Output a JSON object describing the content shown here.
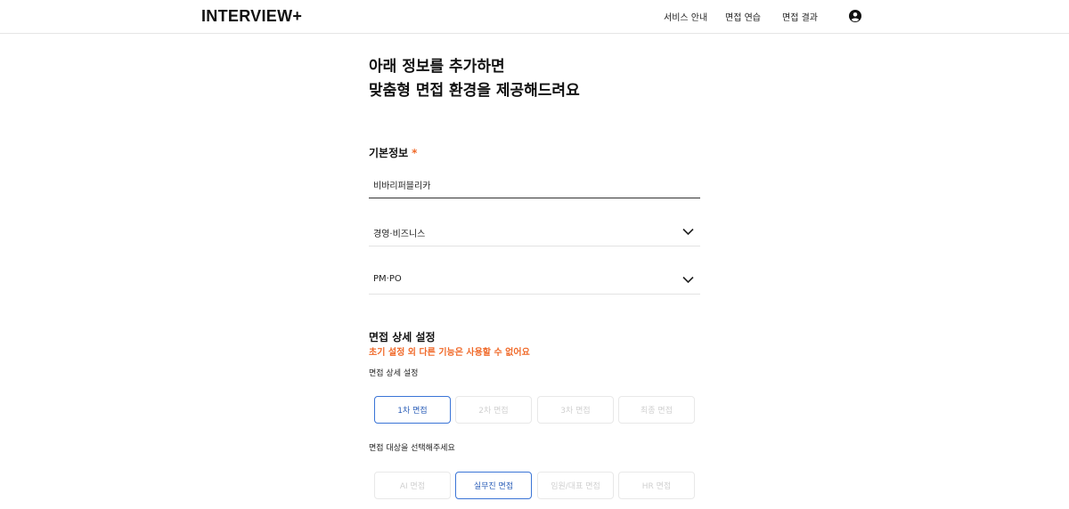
{
  "header": {
    "logo": "INTERVIEW+",
    "nav": [
      "서비스 안내",
      "면접 연습",
      "면접 결과"
    ],
    "profile_icon": "user-circle-icon"
  },
  "main": {
    "headline_line1": "아래 정보를 추가하면",
    "headline_line2": "맞춤형 면접 환경을 제공해드려요",
    "basic_info": {
      "title": "기본정보",
      "required_mark": "*",
      "company_value": "비바리퍼블리카",
      "category_value": "경영·비즈니스",
      "role_value": "PM·PO"
    },
    "detail": {
      "title": "면접 상세 설정",
      "warning": "초기 설정 외 다른 기능은 사용할 수 없어요",
      "round_label": "면접 상세 설정",
      "rounds": [
        "1차 면접",
        "2차 면접",
        "3차 면접",
        "최종 면접"
      ],
      "rounds_selected": 0,
      "target_label": "면접 대상을 선택해주세요",
      "targets": [
        "AI 면접",
        "실무진 면접",
        "임원/대표 면접",
        "HR 면접"
      ],
      "targets_selected": 1
    }
  },
  "colors": {
    "accent": "#3a74d6",
    "warning": "#f06a2a"
  }
}
